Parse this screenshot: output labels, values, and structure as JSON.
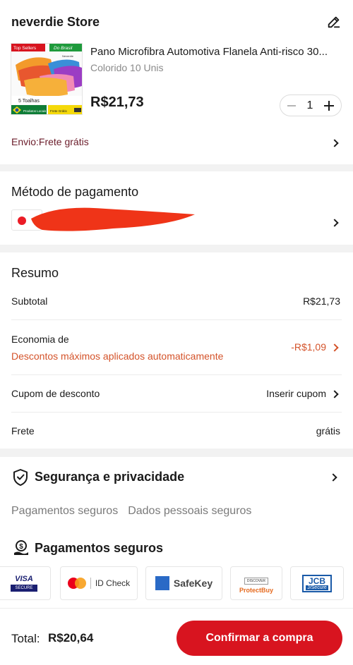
{
  "store": {
    "name": "neverdie Store",
    "product": {
      "title": "Pano Microfibra Automotiva Flanela Anti-risco 30...",
      "variant": "Colorido 10 Unis",
      "price": "R$21,73",
      "quantity": "1",
      "image_labels": {
        "top_sellers": "Top Sellers",
        "do_brasil": "Do Brasil",
        "brand": "Neverdie",
        "count": "5 Toalhas",
        "local": "Produtos Locais",
        "free": "Frete Grátis"
      }
    },
    "shipping": "Envio:Frete grátis"
  },
  "payment": {
    "title": "Método de pagamento"
  },
  "summary": {
    "title": "Resumo",
    "subtotal_label": "Subtotal",
    "subtotal_value": "R$21,73",
    "economy_label": "Economia de",
    "economy_desc": "Descontos máximos aplicados automaticamente",
    "economy_value": "-R$1,09",
    "coupon_label": "Cupom de desconto",
    "coupon_action": "Inserir cupom",
    "shipping_label": "Frete",
    "shipping_value": "grátis"
  },
  "security": {
    "title": "Segurança e privacidade",
    "tabs": [
      "Pagamentos seguros",
      "Dados pessoais seguros"
    ],
    "payments_title": "Pagamentos seguros",
    "brands": {
      "visa": "VISA",
      "visa_sub": "SECURE",
      "mastercard": "ID Check",
      "amex": "SafeKey",
      "discover_top": "DISCOVER",
      "discover": "ProtectBuy",
      "jcb": "JCB",
      "jcb_sub": "J/Secure"
    }
  },
  "footer": {
    "total_label": "Total:",
    "total_value": "R$20,64",
    "confirm_label": "Confirmar a compra"
  },
  "colors": {
    "accent": "#d8141f",
    "discount": "#d4532a",
    "shipping": "#6b1c2a",
    "background": "#f2f2f2"
  }
}
